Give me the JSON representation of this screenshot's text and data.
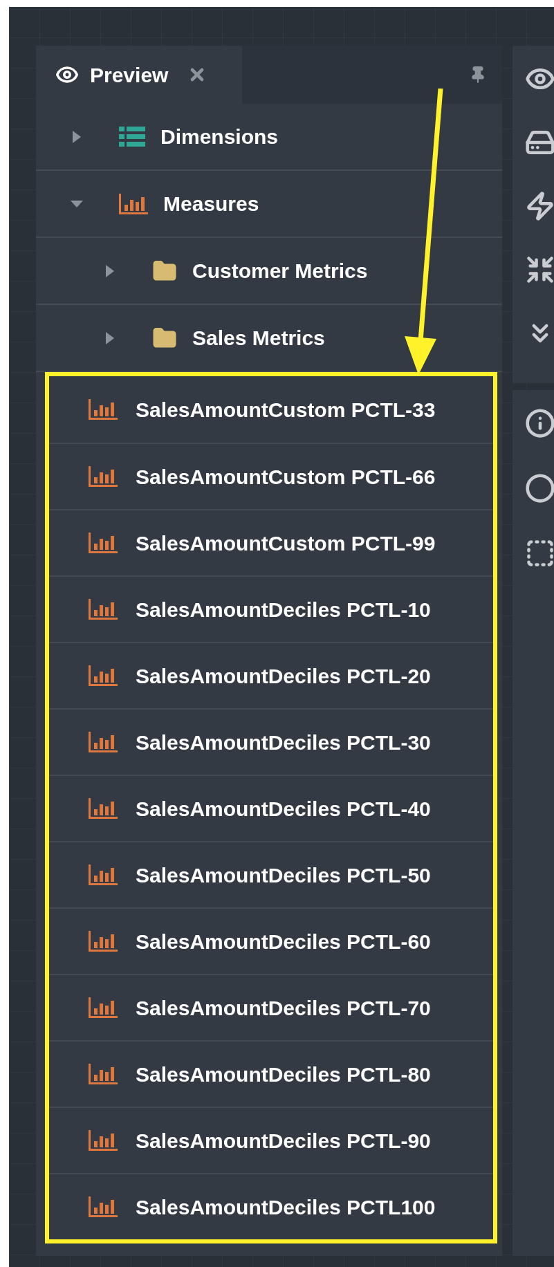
{
  "panel": {
    "tab": {
      "title": "Preview",
      "selected": true
    },
    "tree": [
      {
        "label": "Dimensions",
        "kind": "dimensions",
        "expanded": false
      },
      {
        "label": "Measures",
        "kind": "measures",
        "expanded": true,
        "children": [
          {
            "label": "Customer Metrics",
            "kind": "folder",
            "expanded": false
          },
          {
            "label": "Sales Metrics",
            "kind": "folder",
            "expanded": false
          },
          {
            "label": "SalesAmountCustom PCTL-33",
            "kind": "measure"
          },
          {
            "label": "SalesAmountCustom PCTL-66",
            "kind": "measure"
          },
          {
            "label": "SalesAmountCustom PCTL-99",
            "kind": "measure"
          },
          {
            "label": "SalesAmountDeciles PCTL-10",
            "kind": "measure"
          },
          {
            "label": "SalesAmountDeciles PCTL-20",
            "kind": "measure"
          },
          {
            "label": "SalesAmountDeciles PCTL-30",
            "kind": "measure"
          },
          {
            "label": "SalesAmountDeciles PCTL-40",
            "kind": "measure"
          },
          {
            "label": "SalesAmountDeciles PCTL-50",
            "kind": "measure"
          },
          {
            "label": "SalesAmountDeciles PCTL-60",
            "kind": "measure"
          },
          {
            "label": "SalesAmountDeciles PCTL-70",
            "kind": "measure"
          },
          {
            "label": "SalesAmountDeciles PCTL-80",
            "kind": "measure"
          },
          {
            "label": "SalesAmountDeciles PCTL-90",
            "kind": "measure"
          },
          {
            "label": "SalesAmountDeciles PCTL100",
            "kind": "measure"
          }
        ]
      }
    ]
  }
}
